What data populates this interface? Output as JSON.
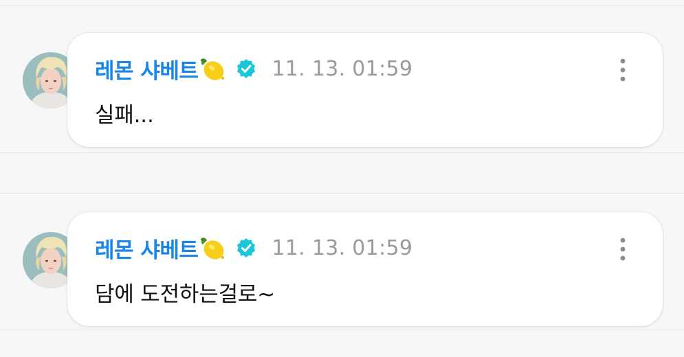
{
  "posts": [
    {
      "author": "레몬 샤베트",
      "author_emoji_icon": "lemon-icon",
      "verified_icon": "verified-badge-icon",
      "timestamp": "11. 13. 01:59",
      "message": "실패...",
      "menu_icon": "more-vertical-icon"
    },
    {
      "author": "레몬 샤베트",
      "author_emoji_icon": "lemon-icon",
      "verified_icon": "verified-badge-icon",
      "timestamp": "11. 13. 01:59",
      "message": "담에 도전하는걸로~",
      "menu_icon": "more-vertical-icon"
    }
  ],
  "colors": {
    "author": "#1a85e6",
    "verified_badge": "#1cc6d9",
    "timestamp": "#9a9a9e",
    "message": "#111111",
    "background": "#f7f7f8",
    "bubble": "#ffffff"
  }
}
